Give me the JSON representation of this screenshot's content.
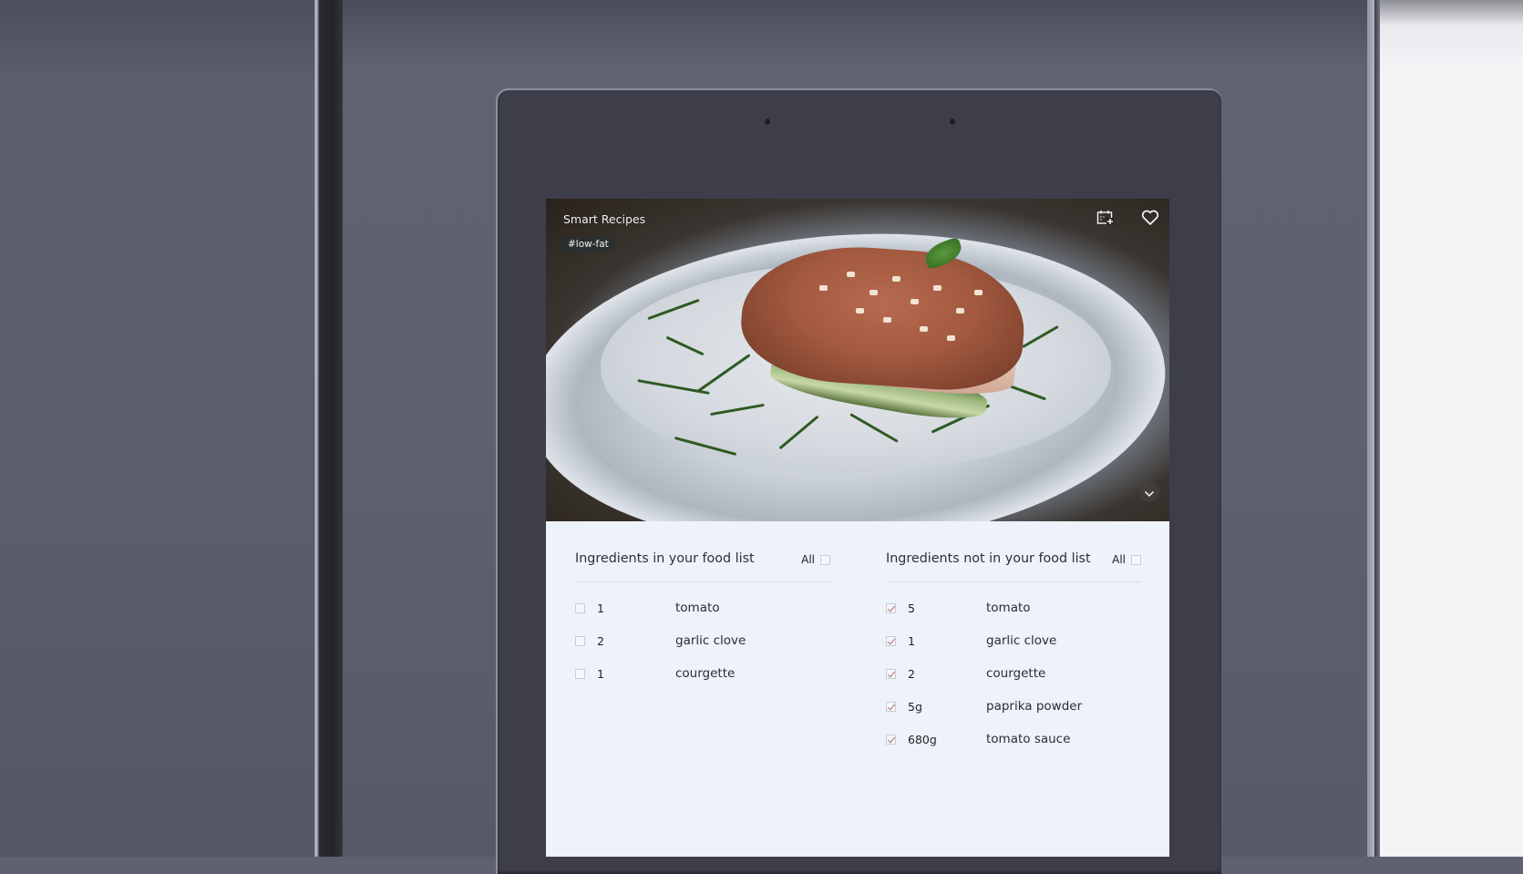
{
  "app": {
    "title": "Smart Recipes",
    "tag": "#low-fat"
  },
  "hero": {
    "image_description": "Plated low-fat dish with paprika-crusted fish over courgette ribbons and herbs",
    "actions": {
      "add_to_calendar_icon": "calendar-plus-icon",
      "favorite_icon": "heart-icon",
      "expand_icon": "chevron-down-icon"
    }
  },
  "ingredients_in_list": {
    "title": "Ingredients in your food list",
    "all_label": "All",
    "all_checked": false,
    "items": [
      {
        "qty": "1",
        "name": "tomato",
        "checked": false
      },
      {
        "qty": "2",
        "name": "garlic clove",
        "checked": false
      },
      {
        "qty": "1",
        "name": "courgette",
        "checked": false
      }
    ]
  },
  "ingredients_not_in_list": {
    "title": "Ingredients not in your food list",
    "all_label": "All",
    "all_checked": false,
    "items": [
      {
        "qty": "5",
        "name": "tomato",
        "checked": true
      },
      {
        "qty": "1",
        "name": "garlic clove",
        "checked": true
      },
      {
        "qty": "2",
        "name": "courgette",
        "checked": true
      },
      {
        "qty": "5g",
        "name": "paprika powder",
        "checked": true
      },
      {
        "qty": "680g",
        "name": "tomato sauce",
        "checked": true
      }
    ]
  },
  "colors": {
    "panel_bg": "#edf2fb",
    "check_mark": "#b36a6a",
    "bezel": "#3e3e4a",
    "fridge_steel": "#5d6170"
  }
}
